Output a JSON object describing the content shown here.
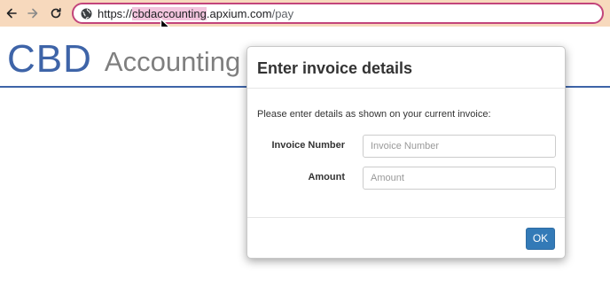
{
  "browser": {
    "url_scheme": "https://",
    "url_host": "cbdaccounting",
    "url_rest": ".apxium.com",
    "url_path": "/pay"
  },
  "logo": {
    "primary": "CBD",
    "secondary": "Accounting"
  },
  "modal": {
    "title": "Enter invoice details",
    "description": "Please enter details as shown on your current invoice:",
    "fields": [
      {
        "label": "Invoice Number",
        "placeholder": "Invoice Number",
        "value": ""
      },
      {
        "label": "Amount",
        "placeholder": "Amount",
        "value": ""
      }
    ],
    "ok_label": "OK"
  },
  "colors": {
    "brand_blue": "#3e64a8",
    "button_blue": "#337ab7",
    "omnibox_border": "#c2447b",
    "toolbar_bg": "#f7d9bd"
  }
}
